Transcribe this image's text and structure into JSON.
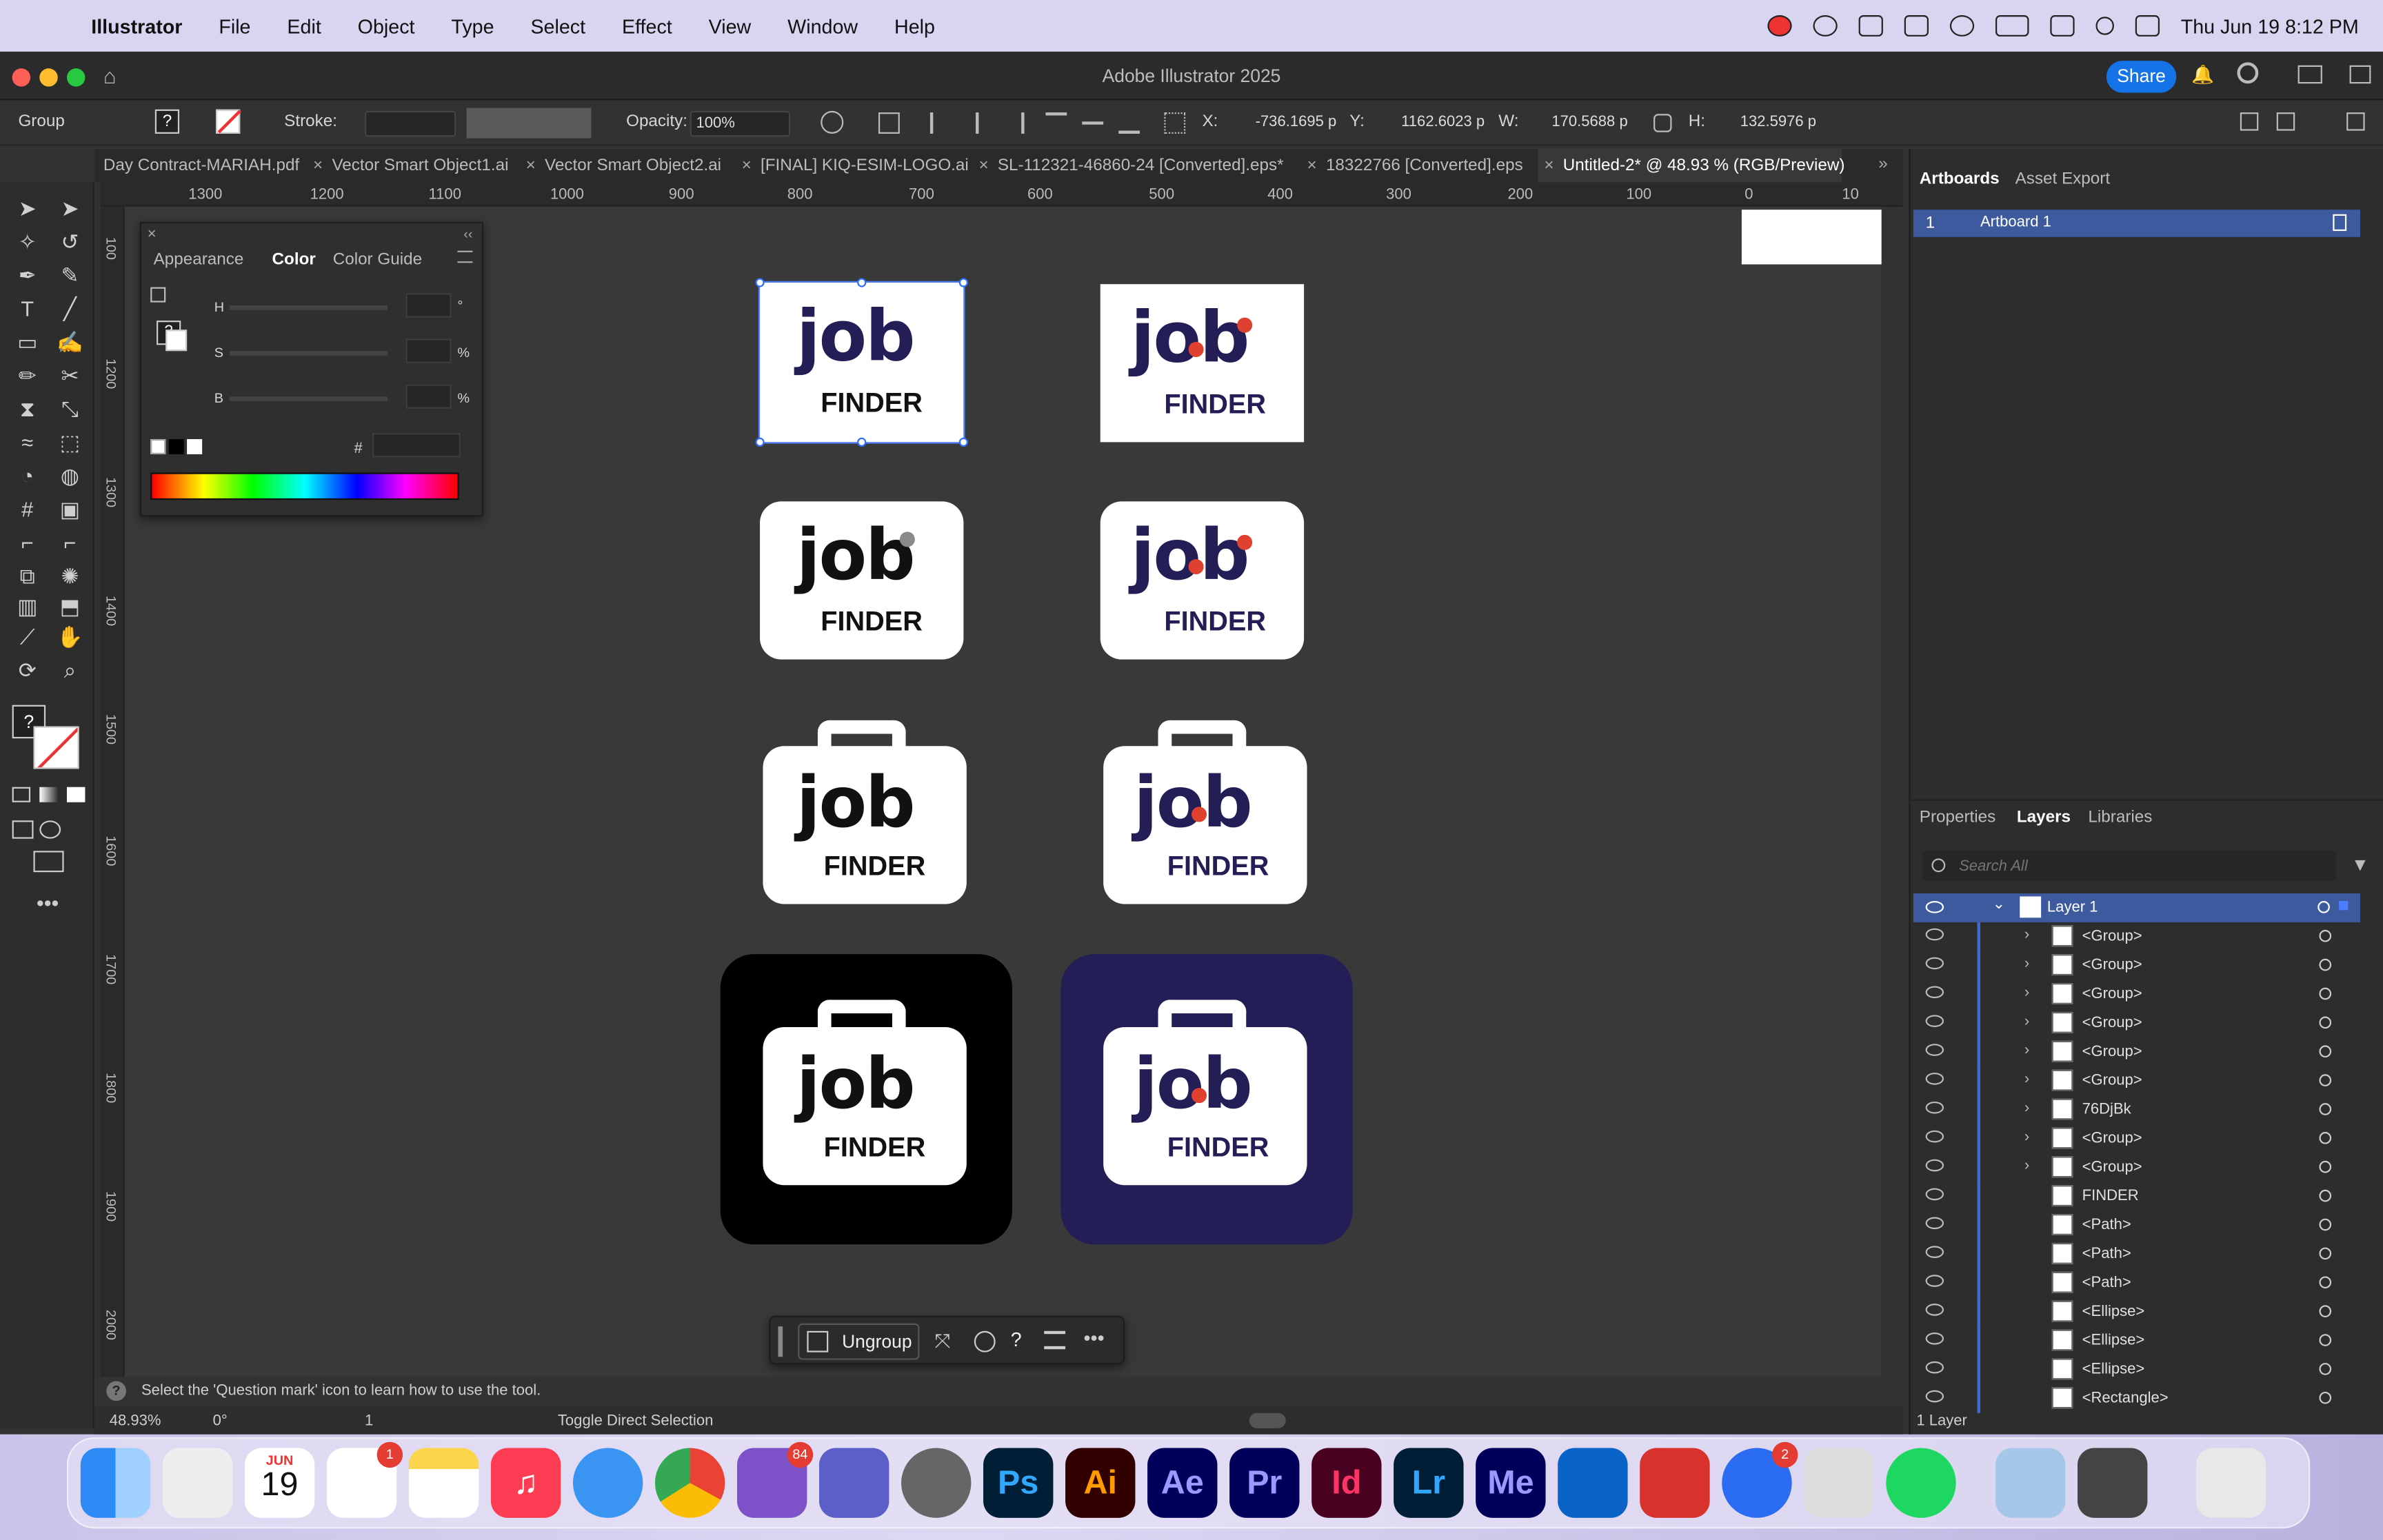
{
  "menubar": {
    "items": [
      "Illustrator",
      "File",
      "Edit",
      "Object",
      "Type",
      "Select",
      "Effect",
      "View",
      "Window",
      "Help"
    ],
    "datetime": "Thu Jun 19  8:12 PM"
  },
  "titlebar": {
    "title": "Adobe Illustrator 2025",
    "share": "Share"
  },
  "control": {
    "selection": "Group",
    "stroke_label": "Stroke:",
    "opacity_label": "Opacity:",
    "opacity": "100%",
    "x_label": "X:",
    "x": "-736.1695 p",
    "y_label": "Y:",
    "y": "1162.6023 p",
    "w_label": "W:",
    "w": "170.5688 p",
    "h_label": "H:",
    "h": "132.5976 p"
  },
  "tabs": [
    {
      "label": "Day Contract-MARIAH.pdf"
    },
    {
      "label": "Vector Smart Object1.ai"
    },
    {
      "label": "Vector Smart Object2.ai"
    },
    {
      "label": "[FINAL] KIQ-ESIM-LOGO.ai"
    },
    {
      "label": "SL-112321-46860-24 [Converted].eps*"
    },
    {
      "label": "18322766 [Converted].eps"
    },
    {
      "label": "Untitled-2* @ 48.93 % (RGB/Preview)"
    }
  ],
  "ruler": {
    "h_ticks": [
      "1300",
      "1200",
      "1100",
      "1000",
      "900",
      "800",
      "700",
      "600",
      "500",
      "400",
      "300",
      "200",
      "100",
      "0",
      "10"
    ],
    "v_ticks": [
      "100",
      "1200",
      "1300",
      "1400",
      "1500",
      "1600",
      "1700",
      "1800",
      "1900",
      "2000"
    ]
  },
  "color_panel": {
    "tabs": [
      "Appearance",
      "Color",
      "Color Guide"
    ],
    "h": "H",
    "s": "S",
    "b": "B",
    "deg": "°",
    "pct": "%",
    "hash": "#"
  },
  "artwork": {
    "word": "job",
    "sub": "FINDER",
    "navy": "#231e55",
    "red": "#e0402f",
    "orange": "#f28c1e",
    "gray": "#8a8a8a"
  },
  "context_bar": {
    "ungroup": "Ungroup"
  },
  "status": {
    "hint": "Select the 'Question mark' icon to learn how to use the tool.",
    "zoom": "48.93%",
    "rotate": "0°",
    "artboard": "1",
    "mode": "Toggle Direct Selection"
  },
  "artboards_panel": {
    "tabs": [
      "Artboards",
      "Asset Export"
    ],
    "rows": [
      {
        "num": "1",
        "name": "Artboard 1"
      }
    ]
  },
  "layers_panel": {
    "tabs": [
      "Properties",
      "Layers",
      "Libraries"
    ],
    "search_placeholder": "Search All",
    "layer_name": "Layer 1",
    "items": [
      "<Group>",
      "<Group>",
      "<Group>",
      "<Group>",
      "<Group>",
      "<Group>",
      "76DjBk",
      "<Group>",
      "<Group>",
      "FINDER",
      "<Path>",
      "<Path>",
      "<Path>",
      "<Ellipse>",
      "<Ellipse>",
      "<Ellipse>",
      "<Rectangle>"
    ],
    "footer": "1 Layer"
  },
  "dock": {
    "calendar_month": "JUN",
    "calendar_day": "19",
    "apps": [
      "Finder",
      "Launchpad",
      "Calendar",
      "Reminders",
      "Notes",
      "Music",
      "Safari",
      "Chrome",
      "Viber",
      "Teams",
      "System Settings",
      "Photoshop",
      "Illustrator",
      "After Effects",
      "Premiere Pro",
      "InDesign",
      "Lightroom",
      "Media Encoder",
      "Outlook",
      "Photo Booth",
      "Messenger",
      "Font Book",
      "Spotify",
      "Preview",
      "Calculator",
      "Trash"
    ],
    "labels": {
      "ps": "Ps",
      "ai": "Ai",
      "ae": "Ae",
      "pr": "Pr",
      "id": "Id",
      "lr": "Lr",
      "me": "Me"
    },
    "badges": {
      "reminders": "1",
      "viber": "84",
      "messenger": "2"
    }
  }
}
